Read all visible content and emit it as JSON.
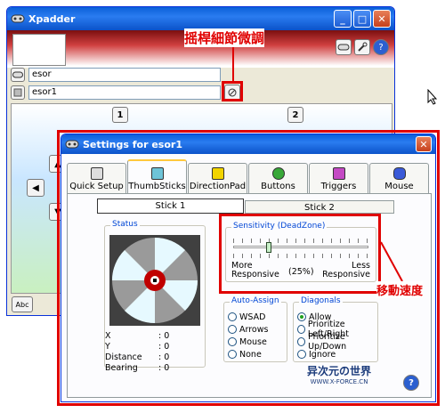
{
  "main_window": {
    "title": "Xpadder",
    "controller_name": "esor",
    "profile_name": "esor1",
    "minimize_glyph": "_",
    "maximize_glyph": "□",
    "close_glyph": "✕",
    "help_glyph": "?",
    "stick_button_left": "1",
    "stick_button_right": "2",
    "arrow_up": "▲",
    "arrow_left": "◀",
    "arrow_down": "▼",
    "abc_label": "Abc"
  },
  "annotations": {
    "thumbstick_settings": "摇桿細節微調",
    "movement_speed": "移動速度"
  },
  "settings": {
    "title": "Settings for esor1",
    "close_glyph": "✕",
    "tabs": [
      {
        "label": "Quick Setup"
      },
      {
        "label": "ThumbSticks"
      },
      {
        "label": "DirectionPad"
      },
      {
        "label": "Buttons"
      },
      {
        "label": "Triggers"
      },
      {
        "label": "Mouse"
      }
    ],
    "sub_tabs": [
      "Stick 1",
      "Stick 2"
    ],
    "status_label": "Status",
    "status": {
      "rows": [
        {
          "k": "X",
          "v": ": 0"
        },
        {
          "k": "Y",
          "v": ": 0"
        },
        {
          "k": "Distance",
          "v": ": 0"
        },
        {
          "k": "Bearing",
          "v": ": 0"
        }
      ]
    },
    "sensitivity": {
      "title": "Sensitivity (DeadZone)",
      "value": "(25%)",
      "value_fraction": 0.25,
      "left_label_1": "More",
      "left_label_2": "Responsive",
      "right_label_1": "Less",
      "right_label_2": "Responsive"
    },
    "auto_assign": {
      "title": "Auto-Assign",
      "options": [
        "WSAD",
        "Arrows",
        "Mouse",
        "None"
      ]
    },
    "diagonals": {
      "title": "Diagonals",
      "options": [
        "Allow",
        "Prioritize Left/Right",
        "Prioritize Up/Down",
        "Ignore"
      ],
      "selected": 0
    },
    "help_glyph": "?"
  },
  "watermark": {
    "line1": "异次元の世界",
    "line2": "WWW.X-FORCE.CN"
  },
  "colors": {
    "accent_red": "#e00000",
    "title_blue": "#0a5fd8",
    "panel_bg": "#ece9d8"
  }
}
